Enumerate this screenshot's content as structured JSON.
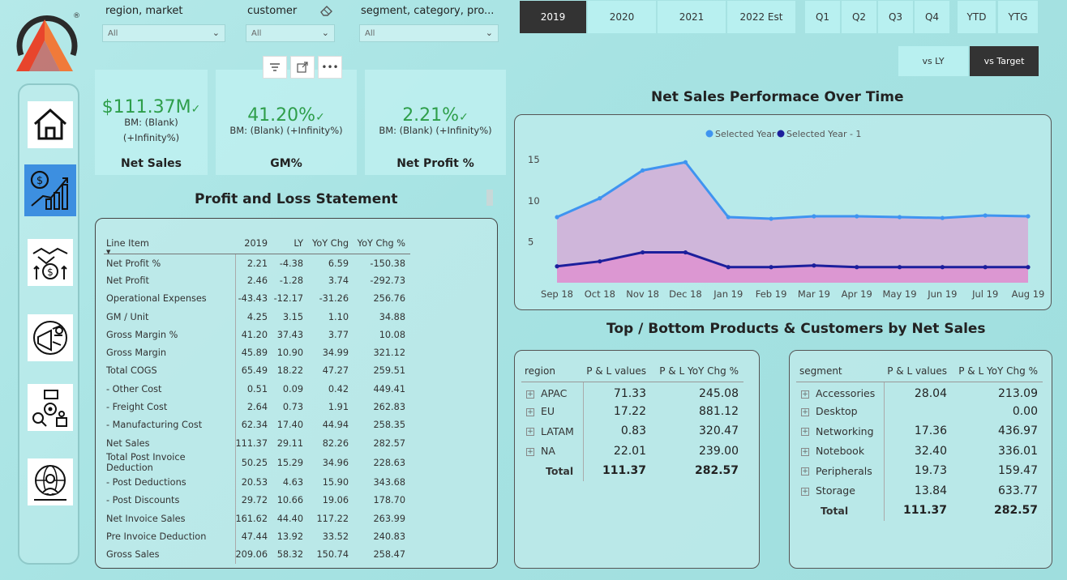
{
  "logo": {
    "registered": "®",
    "accent": "#e8452c"
  },
  "nav": {
    "items": [
      {
        "name": "home-icon"
      },
      {
        "name": "finance-chart-icon"
      },
      {
        "name": "handshake-money-icon"
      },
      {
        "name": "marketing-megaphone-icon"
      },
      {
        "name": "supply-chain-icon"
      },
      {
        "name": "global-user-icon"
      }
    ]
  },
  "slicers": {
    "region": {
      "label": "region, market",
      "value": "All"
    },
    "customer": {
      "label": "customer",
      "value": "All"
    },
    "segment": {
      "label": "segment, category, pro...",
      "value": "All"
    }
  },
  "years": [
    "2019",
    "2020",
    "2021",
    "2022 Est"
  ],
  "quarters": [
    "Q1",
    "Q2",
    "Q3",
    "Q4"
  ],
  "periods": [
    "YTD",
    "YTG"
  ],
  "targets": [
    "vs LY",
    "vs Target"
  ],
  "kpis": [
    {
      "value": "$111.37M",
      "bm1": "BM: (Blank)",
      "bm2": "(+Infinity%)",
      "name": "Net Sales"
    },
    {
      "value": "41.20%",
      "bm1": "BM: (Blank) (+Infinity%)",
      "bm2": "",
      "name": "GM%"
    },
    {
      "value": "2.21%",
      "bm1": "BM: (Blank) (+Infinity%)",
      "bm2": "",
      "name": "Net Profit %"
    }
  ],
  "pl": {
    "title": "Profit and Loss Statement",
    "headers": [
      "Line Item",
      "2019",
      "LY",
      "YoY Chg",
      "YoY Chg %"
    ],
    "rows": [
      [
        "Net Profit %",
        "2.21",
        "-4.38",
        "6.59",
        "-150.38"
      ],
      [
        "Net Profit",
        "2.46",
        "-1.28",
        "3.74",
        "-292.73"
      ],
      [
        "Operational Expenses",
        "-43.43",
        "-12.17",
        "-31.26",
        "256.76"
      ],
      [
        "GM / Unit",
        "4.25",
        "3.15",
        "1.10",
        "34.88"
      ],
      [
        "Gross Margin %",
        "41.20",
        "37.43",
        "3.77",
        "10.08"
      ],
      [
        "Gross Margin",
        "45.89",
        "10.90",
        "34.99",
        "321.12"
      ],
      [
        "Total COGS",
        "65.49",
        "18.22",
        "47.27",
        "259.51"
      ],
      [
        "- Other Cost",
        "0.51",
        "0.09",
        "0.42",
        "449.41"
      ],
      [
        "- Freight Cost",
        "2.64",
        "0.73",
        "1.91",
        "262.83"
      ],
      [
        "- Manufacturing Cost",
        "62.34",
        "17.40",
        "44.94",
        "258.35"
      ],
      [
        "Net Sales",
        "111.37",
        "29.11",
        "82.26",
        "282.57"
      ],
      [
        "Total Post Invoice Deduction",
        "50.25",
        "15.29",
        "34.96",
        "228.63"
      ],
      [
        "- Post Deductions",
        "20.53",
        "4.63",
        "15.90",
        "343.68"
      ],
      [
        "- Post Discounts",
        "29.72",
        "10.66",
        "19.06",
        "178.70"
      ],
      [
        "Net Invoice Sales",
        "161.62",
        "44.40",
        "117.22",
        "263.99"
      ],
      [
        "Pre Invoice Deduction",
        "47.44",
        "13.92",
        "33.52",
        "240.83"
      ],
      [
        "Gross Sales",
        "209.06",
        "58.32",
        "150.74",
        "258.47"
      ]
    ]
  },
  "chart_title": "Net Sales Performace Over Time",
  "chart_data": {
    "type": "area",
    "x": [
      "Sep 18",
      "Oct 18",
      "Nov 18",
      "Dec 18",
      "Jan 19",
      "Feb 19",
      "Mar 19",
      "Apr 19",
      "May 19",
      "Jun 19",
      "Jul 19",
      "Aug 19"
    ],
    "series": [
      {
        "name": "Selected Year",
        "values": [
          8.0,
          10.3,
          13.7,
          14.7,
          8.0,
          7.8,
          8.1,
          8.1,
          8.0,
          7.9,
          8.2,
          8.1
        ],
        "color": "#3f94f0"
      },
      {
        "name": "Selected Year - 1",
        "values": [
          2.0,
          2.6,
          3.7,
          3.7,
          1.9,
          1.9,
          2.1,
          1.9,
          1.9,
          1.9,
          1.9,
          1.9
        ],
        "color": "#1c1f9c"
      }
    ],
    "yticks": [
      5,
      10,
      15
    ],
    "ylim": [
      0,
      16.5
    ],
    "legend": "top-center",
    "grid": false
  },
  "tb_title": "Top / Bottom Products & Customers by Net Sales",
  "region_table": {
    "headers": [
      "region",
      "P & L values",
      "P & L YoY Chg %"
    ],
    "rows": [
      [
        "APAC",
        "71.33",
        "245.08"
      ],
      [
        "EU",
        "17.22",
        "881.12"
      ],
      [
        "LATAM",
        "0.83",
        "320.47"
      ],
      [
        "NA",
        "22.01",
        "239.00"
      ]
    ],
    "total": [
      "Total",
      "111.37",
      "282.57"
    ]
  },
  "segment_table": {
    "headers": [
      "segment",
      "P & L values",
      "P & L YoY Chg %"
    ],
    "rows": [
      [
        "Accessories",
        "28.04",
        "213.09"
      ],
      [
        "Desktop",
        "",
        "0.00"
      ],
      [
        "Networking",
        "17.36",
        "436.97"
      ],
      [
        "Notebook",
        "32.40",
        "336.01"
      ],
      [
        "Peripherals",
        "19.73",
        "159.47"
      ],
      [
        "Storage",
        "13.84",
        "633.77"
      ]
    ],
    "total": [
      "Total",
      "111.37",
      "282.57"
    ]
  }
}
